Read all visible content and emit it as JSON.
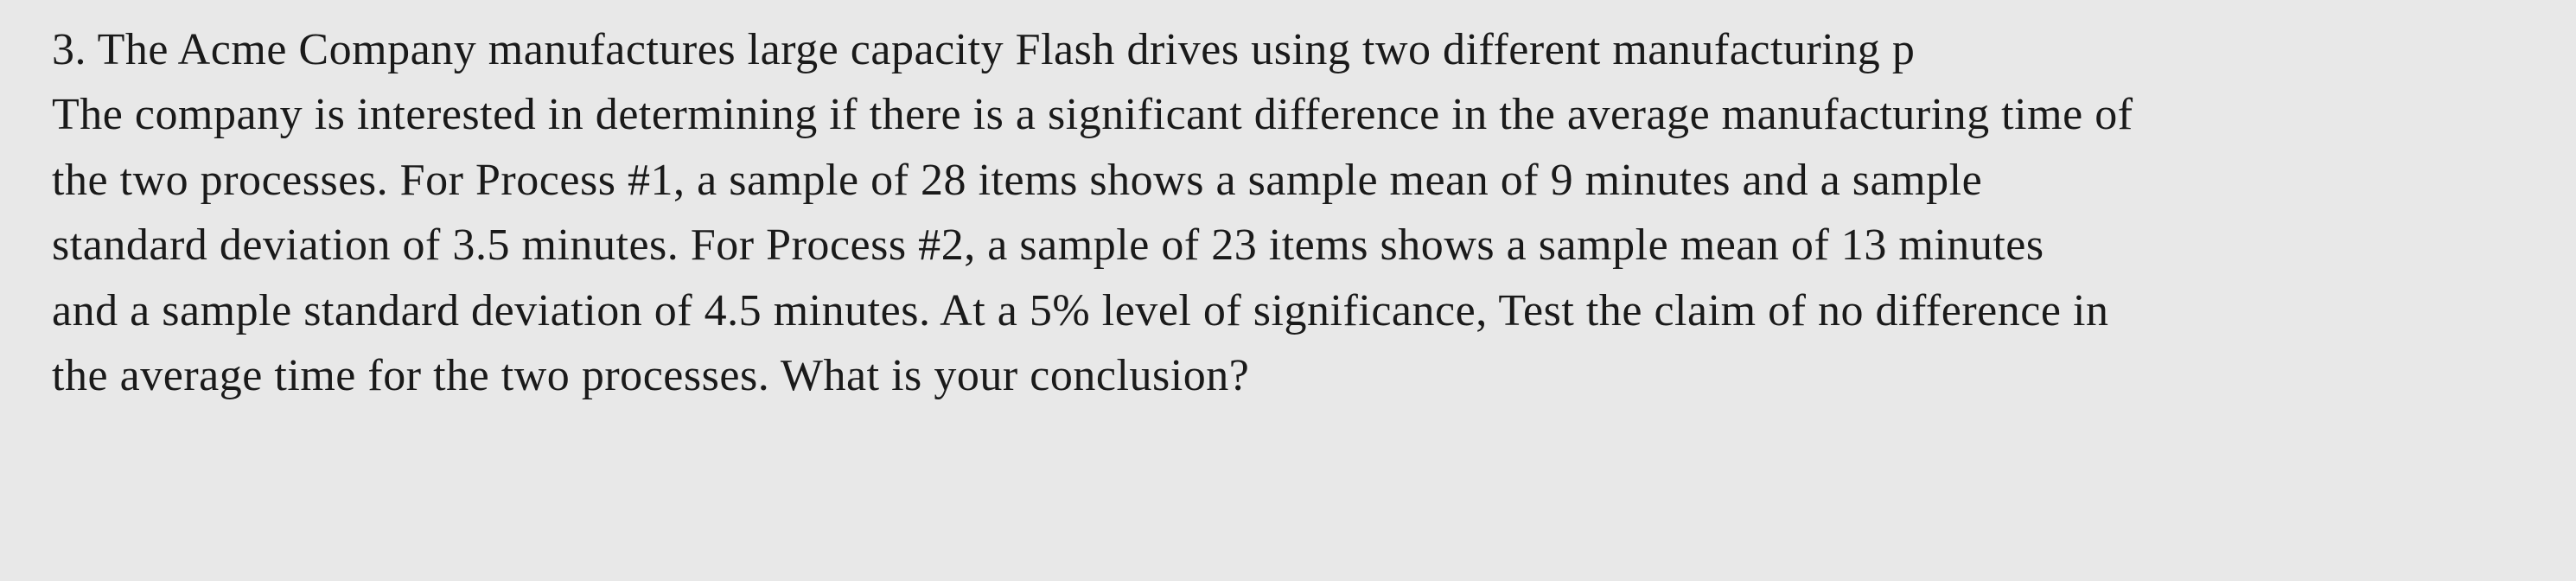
{
  "problem": {
    "text_line1": "3. The Acme Company manufactures large capacity Flash drives using two different manufacturing p...",
    "text_line2": "The company is interested in determining if there is a significant difference in the average manufacturing time of",
    "text_line3": "the two processes. For Process #1, a sample of 28 items shows a sample mean of 9 minutes and a sample",
    "text_line4": "standard deviation of 3.5 minutes. For Process #2, a sample of 23 items shows a sample mean of 13 minutes",
    "text_line5": "and a sample standard deviation of 4.5 minutes. At a 5% level of significance, Test the claim of no difference in",
    "text_line6": "the average time for the two processes. What is your conclusion?",
    "full_text": "3. The Acme Company manufactures large capacity Flash drives using two different manufacturing p...\nThe company is interested in determining if there is a significant difference in the average manufacturing time of the two processes. For Process #1, a sample of 28 items shows a sample mean of 9 minutes and a sample standard deviation of 3.5 minutes. For Process #2, a sample of 23 items shows a sample mean of 13 minutes and a sample standard deviation of 4.5 minutes. At a 5% level of significance, Test the claim of no difference in the average time for the two processes. What is your conclusion?"
  },
  "colors": {
    "background": "#e8e8e8",
    "text": "#1a1a1a"
  }
}
